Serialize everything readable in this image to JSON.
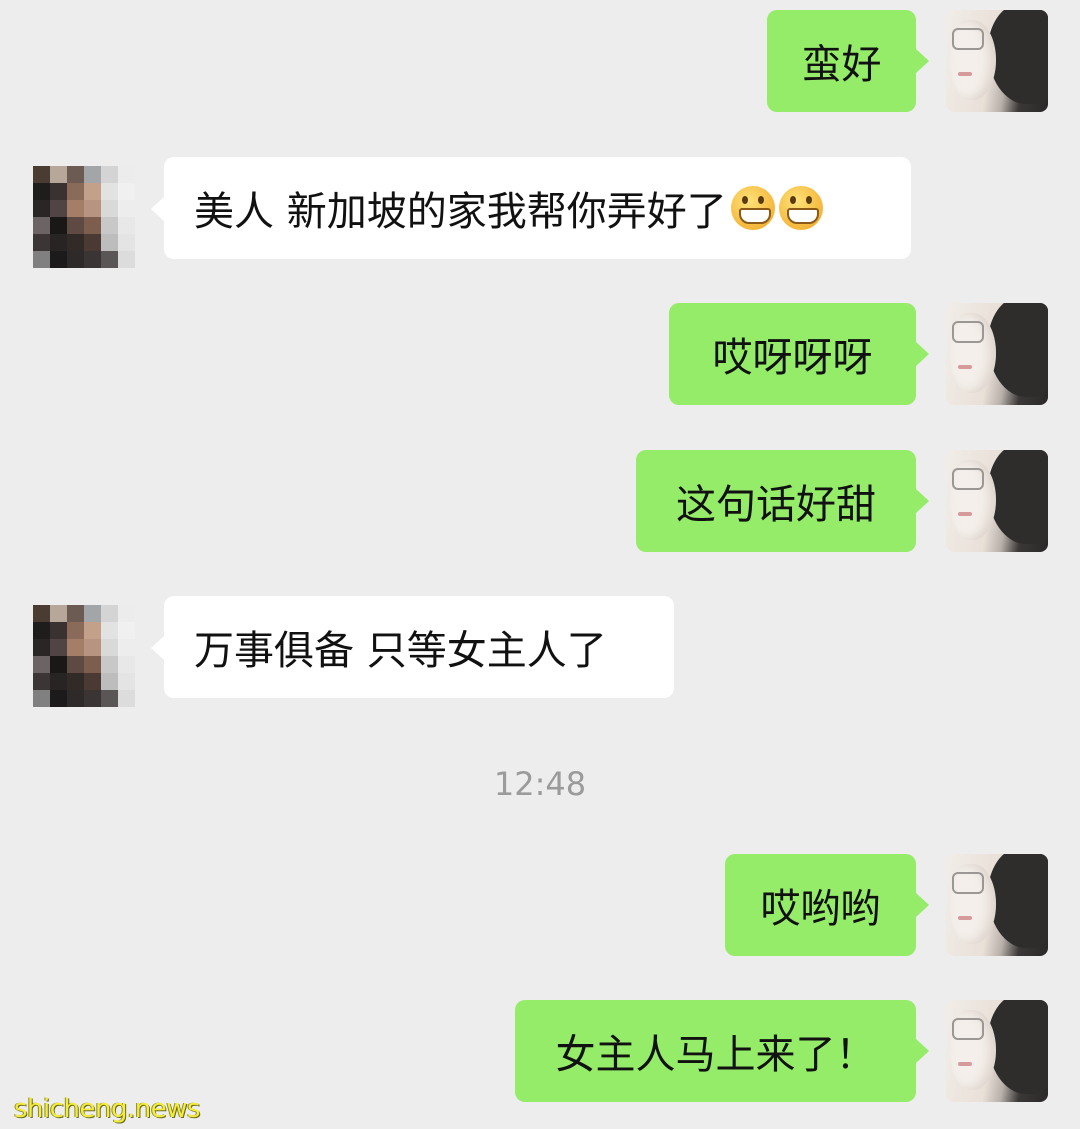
{
  "messages": [
    {
      "side": "self",
      "text": "蛮好"
    },
    {
      "side": "other",
      "text": "美人 新加坡的家我帮你弄好了",
      "emoji": [
        "grimacing-face-icon",
        "grimacing-face-icon"
      ]
    },
    {
      "side": "self",
      "text": "哎呀呀呀"
    },
    {
      "side": "self",
      "text": "这句话好甜"
    },
    {
      "side": "other",
      "text": "万事俱备 只等女主人了"
    },
    {
      "side": "self",
      "text": "哎哟哟"
    },
    {
      "side": "self",
      "text": "女主人马上来了！"
    }
  ],
  "timestamp": "12:48",
  "watermark": "shicheng.news",
  "colors": {
    "self_bubble": "#95ec69",
    "other_bubble": "#ffffff",
    "background": "#ededed"
  }
}
